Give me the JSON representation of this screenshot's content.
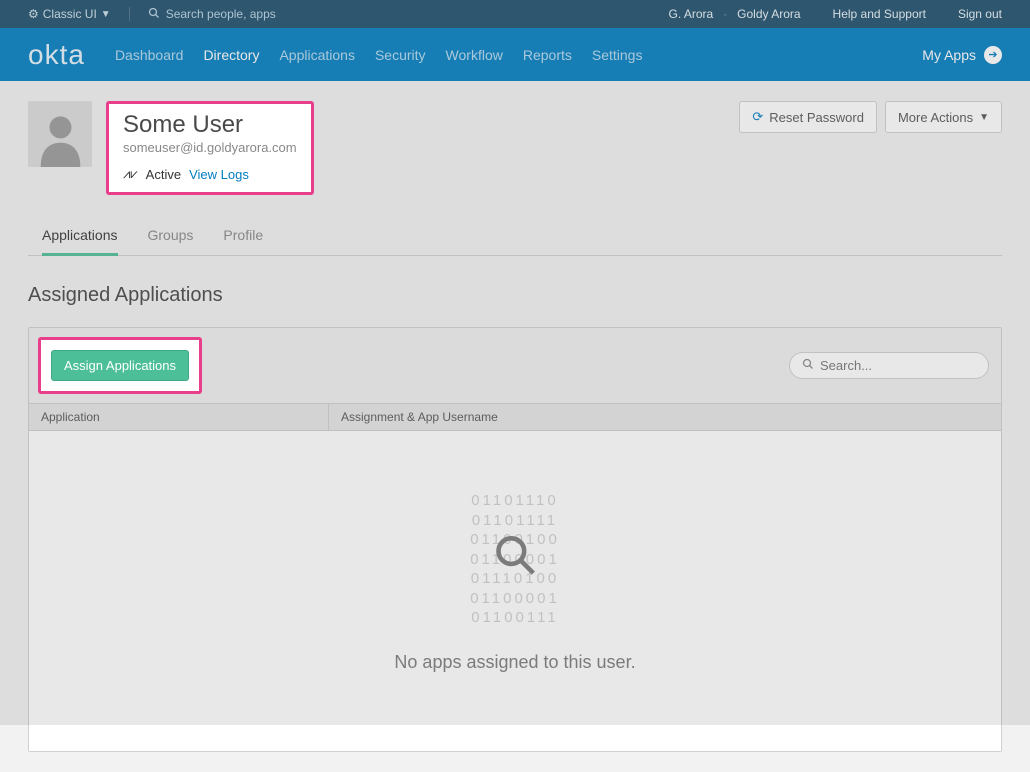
{
  "topbar": {
    "mode": "Classic UI",
    "search_placeholder": "Search people, apps",
    "user_short": "G. Arora",
    "user_full": "Goldy Arora",
    "help": "Help and Support",
    "signout": "Sign out"
  },
  "nav": {
    "logo": "okta",
    "items": [
      "Dashboard",
      "Directory",
      "Applications",
      "Security",
      "Workflow",
      "Reports",
      "Settings"
    ],
    "active_index": 1,
    "my_apps": "My Apps"
  },
  "user": {
    "name": "Some User",
    "email": "someuser@id.goldyarora.com",
    "status": "Active",
    "view_logs": "View Logs"
  },
  "actions": {
    "reset_password": "Reset Password",
    "more": "More Actions"
  },
  "tabs": {
    "items": [
      "Applications",
      "Groups",
      "Profile"
    ],
    "active_index": 0
  },
  "section": {
    "title": "Assigned Applications"
  },
  "panel": {
    "assign_btn": "Assign Applications",
    "search_placeholder": "Search...",
    "col1": "Application",
    "col2": "Assignment & App Username"
  },
  "empty": {
    "binary": [
      "01101110",
      "01101111",
      "01100100",
      "01100001",
      "01110100",
      "01100001",
      "01100111"
    ],
    "message": "No apps assigned to this user."
  }
}
